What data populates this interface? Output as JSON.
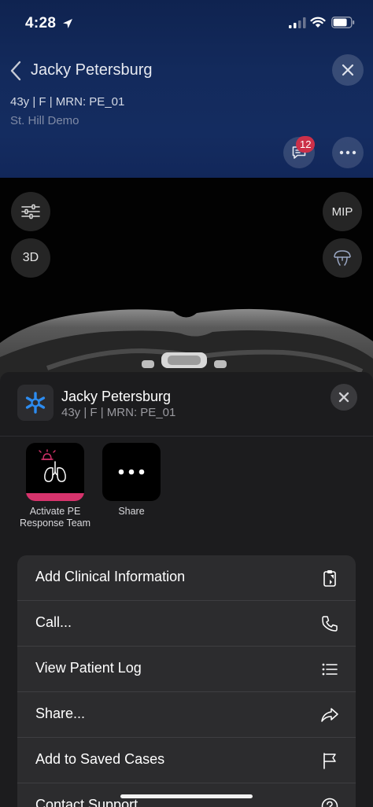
{
  "status_bar": {
    "time": "4:28"
  },
  "header": {
    "title": "Jacky Petersburg",
    "meta": "43y  |  F  |  MRN: PE_01",
    "site": "St. Hill Demo",
    "chat_badge": "12"
  },
  "viewer": {
    "tools_left": [
      "filter-sliders",
      "3D"
    ],
    "tools_right": [
      "MIP",
      "anatomy"
    ],
    "three_d_label": "3D",
    "mip_label": "MIP"
  },
  "sheet": {
    "patient_name": "Jacky Petersburg",
    "patient_meta": "43y  |  F  |  MRN: PE_01",
    "actions": [
      {
        "label": "Activate PE Response Team",
        "label_line1": "Activate PE",
        "label_line2": "Response Team",
        "icon": "lungs-alarm-icon",
        "accent": "#d6336c"
      },
      {
        "label": "Share",
        "icon": "ellipsis-icon"
      }
    ],
    "menu": [
      {
        "label": "Add Clinical Information",
        "icon": "clipboard-icon"
      },
      {
        "label": "Call...",
        "icon": "phone-icon"
      },
      {
        "label": "View Patient Log",
        "icon": "list-icon"
      },
      {
        "label": "Share...",
        "icon": "share-arrow-icon"
      },
      {
        "label": "Add to Saved Cases",
        "icon": "flag-icon"
      },
      {
        "label": "Contact Support",
        "icon": "help-icon"
      }
    ]
  },
  "colors": {
    "header_bg": "#132a5c",
    "badge": "#cc3049",
    "accent_pink": "#d6336c",
    "brand_blue": "#2d8cf0",
    "sheet_bg": "#1c1c1e",
    "menu_bg": "#2c2c2e"
  }
}
